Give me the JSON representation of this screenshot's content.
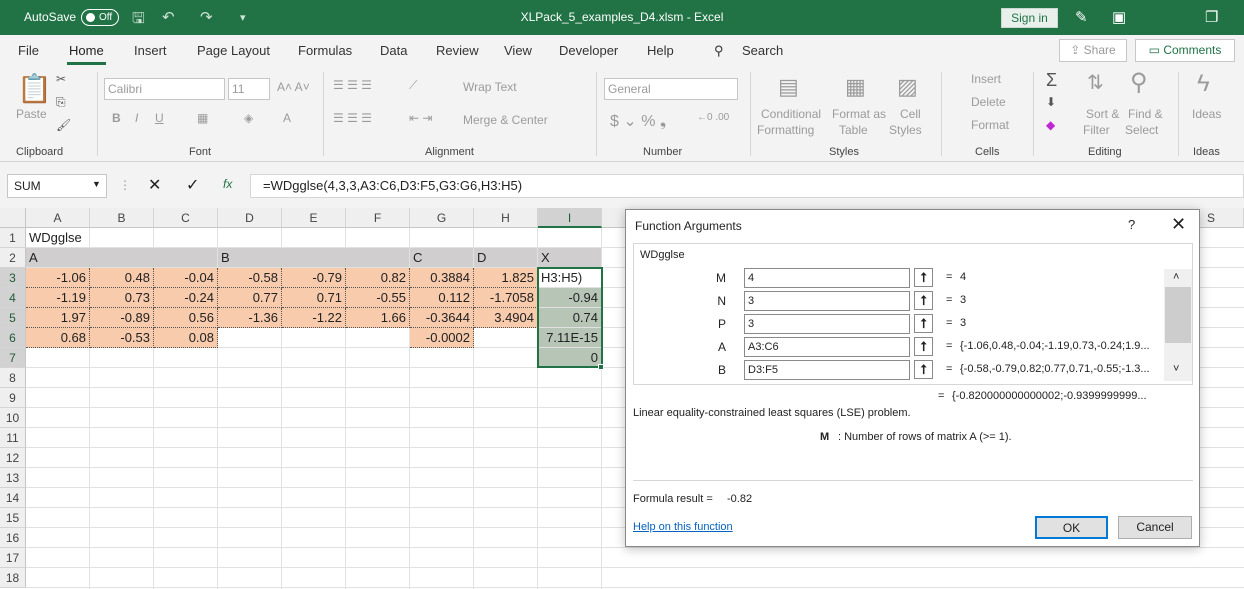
{
  "titlebar": {
    "autosave": "AutoSave",
    "toggle": "Off",
    "doc": "XLPack_5_examples_D4.xlsm  -  Excel",
    "signin": "Sign in"
  },
  "menu": [
    "File",
    "Home",
    "Insert",
    "Page Layout",
    "Formulas",
    "Data",
    "Review",
    "View",
    "Developer",
    "Help"
  ],
  "search": "Search",
  "share": "Share",
  "comments": "Comments",
  "ribbon": {
    "paste": "Paste",
    "clipboard": "Clipboard",
    "font_name": "Calibri",
    "font_size": "11",
    "font": "Font",
    "wrap": "Wrap Text",
    "merge": "Merge & Center",
    "alignment": "Alignment",
    "numfmt": "General",
    "number": "Number",
    "cond1": "Conditional",
    "cond2": "Formatting",
    "fmt1": "Format as",
    "fmt2": "Table",
    "cell1": "Cell",
    "cell2": "Styles",
    "styles": "Styles",
    "insert": "Insert",
    "delete": "Delete",
    "format": "Format",
    "cells": "Cells",
    "sort1": "Sort &",
    "sort2": "Filter",
    "find1": "Find &",
    "find2": "Select",
    "editing": "Editing",
    "ideas": "Ideas"
  },
  "namebox": "SUM",
  "formula": "=WDgglse(4,3,3,A3:C6,D3:F5,G3:G6,H3:H5)",
  "columns": [
    "A",
    "B",
    "C",
    "D",
    "E",
    "F",
    "G",
    "H",
    "I",
    "S"
  ],
  "rows": [
    "1",
    "2",
    "3",
    "4",
    "5",
    "6",
    "7",
    "8",
    "9",
    "10",
    "11",
    "12",
    "13",
    "14",
    "15",
    "16",
    "17",
    "18"
  ],
  "cells": {
    "r1": "WDgglse",
    "r2": [
      "A",
      "B",
      "C",
      "D",
      "X"
    ],
    "r3": [
      "-1.06",
      "0.48",
      "-0.04",
      "-0.58",
      "-0.79",
      "0.82",
      "0.3884",
      "1.825",
      "H3:H5)"
    ],
    "r4": [
      "-1.19",
      "0.73",
      "-0.24",
      "0.77",
      "0.71",
      "-0.55",
      "0.112",
      "-1.7058",
      "-0.94"
    ],
    "r5": [
      "1.97",
      "-0.89",
      "0.56",
      "-1.36",
      "-1.22",
      "1.66",
      "-0.3644",
      "3.4904",
      "0.74"
    ],
    "r6": [
      "0.68",
      "-0.53",
      "0.08",
      "",
      "",
      "",
      "-0.0002",
      "",
      "7.11E-15"
    ],
    "r7": "0"
  },
  "dialog": {
    "title": "Function Arguments",
    "help": "?",
    "close": "✕",
    "fn": "WDgglse",
    "args": [
      {
        "label": "M",
        "input": "4",
        "value": "4"
      },
      {
        "label": "N",
        "input": "3",
        "value": "3"
      },
      {
        "label": "P",
        "input": "3",
        "value": "3"
      },
      {
        "label": "A",
        "input": "A3:C6",
        "value": "{-1.06,0.48,-0.04;-1.19,0.73,-0.24;1.9..."
      },
      {
        "label": "B",
        "input": "D3:F5",
        "value": "{-0.58,-0.79,0.82;0.77,0.71,-0.55;-1.3..."
      }
    ],
    "result_preview": "{-0.820000000000002;-0.9399999999...",
    "description": "Linear equality-constrained least squares (LSE) problem.",
    "arg_name": "M",
    "arg_desc": ":  Number of rows of matrix A (>= 1).",
    "formula_result_label": "Formula result =",
    "formula_result": "-0.82",
    "help_link": "Help on this function",
    "ok": "OK",
    "cancel": "Cancel"
  }
}
